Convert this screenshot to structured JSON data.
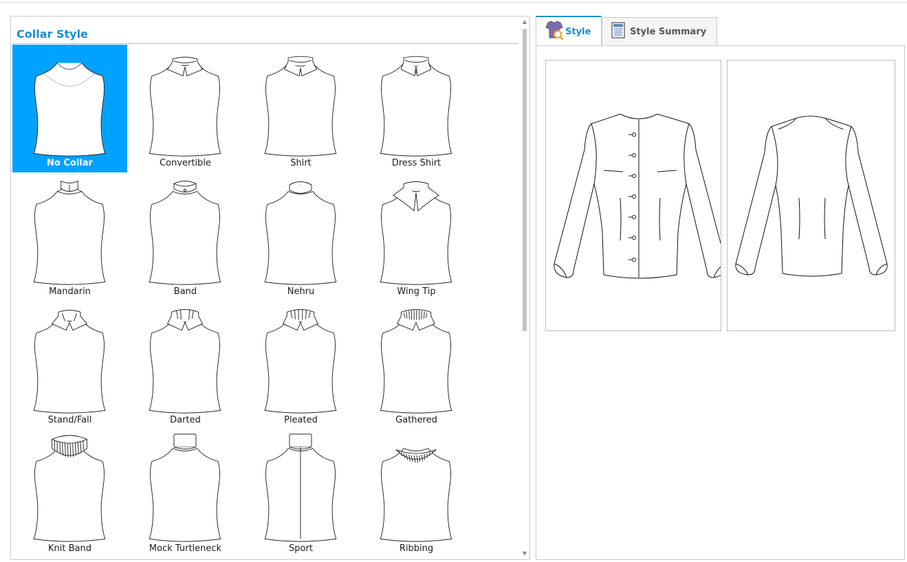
{
  "panel": {
    "title": "Collar Style"
  },
  "collars": [
    {
      "label": "No Collar",
      "selected": true,
      "neck": "round"
    },
    {
      "label": "Convertible",
      "selected": false,
      "neck": "convertible"
    },
    {
      "label": "Shirt",
      "selected": false,
      "neck": "shirt"
    },
    {
      "label": "Dress Shirt",
      "selected": false,
      "neck": "dress-shirt"
    },
    {
      "label": "Mandarin",
      "selected": false,
      "neck": "mandarin"
    },
    {
      "label": "Band",
      "selected": false,
      "neck": "band"
    },
    {
      "label": "Nehru",
      "selected": false,
      "neck": "nehru"
    },
    {
      "label": "Wing Tip",
      "selected": false,
      "neck": "wing-tip"
    },
    {
      "label": "Stand/Fall",
      "selected": false,
      "neck": "stand-fall"
    },
    {
      "label": "Darted",
      "selected": false,
      "neck": "darted"
    },
    {
      "label": "Pleated",
      "selected": false,
      "neck": "pleated"
    },
    {
      "label": "Gathered",
      "selected": false,
      "neck": "gathered"
    },
    {
      "label": "Knit Band",
      "selected": false,
      "neck": "knit-band"
    },
    {
      "label": "Mock Turtleneck",
      "selected": false,
      "neck": "mock-turtleneck"
    },
    {
      "label": "Sport",
      "selected": false,
      "neck": "sport"
    },
    {
      "label": "Ribbing",
      "selected": false,
      "neck": "ribbing"
    }
  ],
  "tabs": [
    {
      "label": "Style",
      "active": true,
      "icon": "shirt-search-icon"
    },
    {
      "label": "Style Summary",
      "active": false,
      "icon": "document-icon"
    }
  ],
  "colors": {
    "accent": "#1a8fd4",
    "selected_bg": "#00a2ff"
  },
  "preview": {
    "views": [
      "front-view",
      "back-view"
    ]
  }
}
